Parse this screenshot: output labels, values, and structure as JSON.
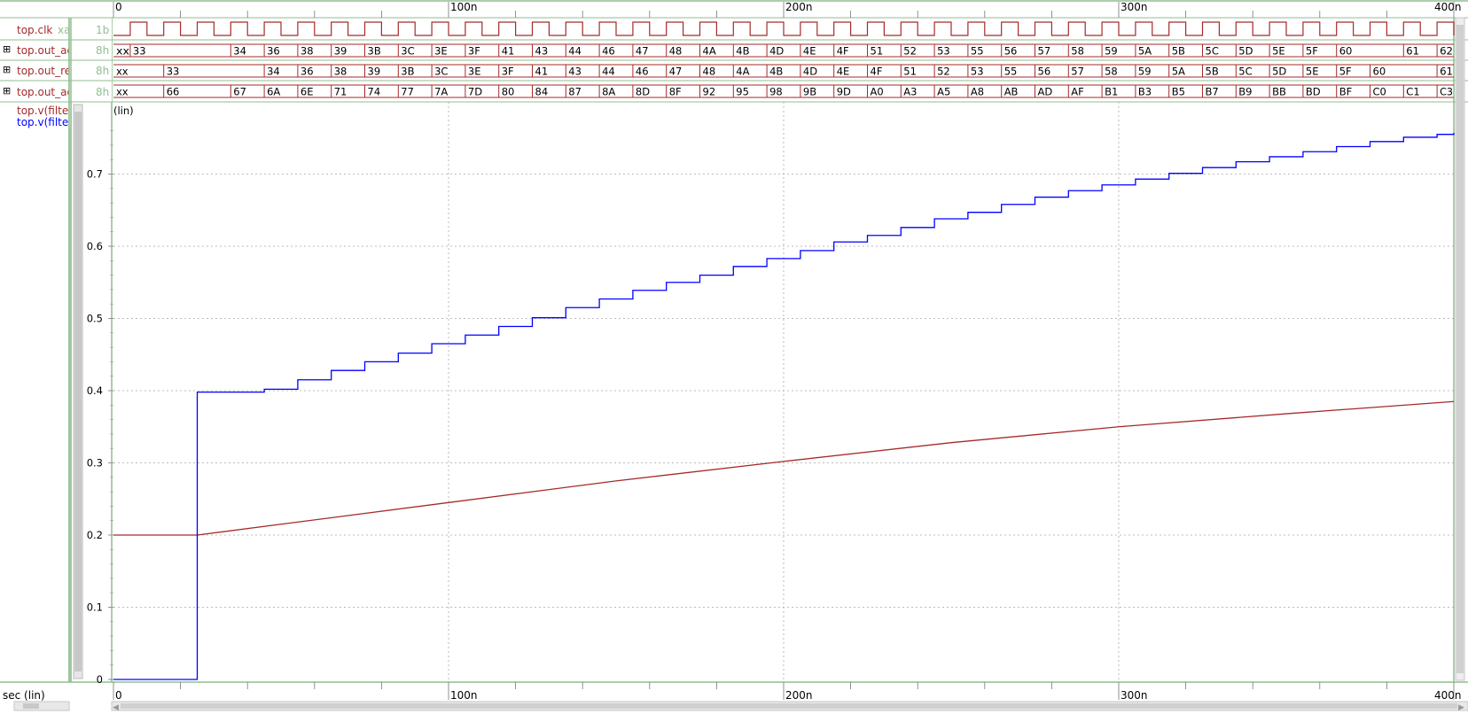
{
  "colors": {
    "signal_name": "#a52a2a",
    "trace_red": "#a52a2a",
    "trace_blue": "#0000ff",
    "size_label": "#8fbf8f",
    "frame_green": "#8fbf8f",
    "grid": "#a8a8a8"
  },
  "signals": [
    {
      "name": "top.clk",
      "suffix": "xa",
      "size": "1b",
      "expandable": false,
      "kind": "clock",
      "period_ns": 10,
      "first_rise_ns": 5
    },
    {
      "name": "top.out_ad",
      "size": "8h",
      "expandable": true,
      "kind": "bus",
      "segments": [
        {
          "t": 0,
          "v": "xx"
        },
        {
          "t": 5,
          "v": "33"
        },
        {
          "t": 35,
          "v": "34"
        },
        {
          "t": 45,
          "v": "36"
        },
        {
          "t": 55,
          "v": "38"
        },
        {
          "t": 65,
          "v": "39"
        },
        {
          "t": 75,
          "v": "3B"
        },
        {
          "t": 85,
          "v": "3C"
        },
        {
          "t": 95,
          "v": "3E"
        },
        {
          "t": 105,
          "v": "3F"
        },
        {
          "t": 115,
          "v": "41"
        },
        {
          "t": 125,
          "v": "43"
        },
        {
          "t": 135,
          "v": "44"
        },
        {
          "t": 145,
          "v": "46"
        },
        {
          "t": 155,
          "v": "47"
        },
        {
          "t": 165,
          "v": "48"
        },
        {
          "t": 175,
          "v": "4A"
        },
        {
          "t": 185,
          "v": "4B"
        },
        {
          "t": 195,
          "v": "4D"
        },
        {
          "t": 205,
          "v": "4E"
        },
        {
          "t": 215,
          "v": "4F"
        },
        {
          "t": 225,
          "v": "51"
        },
        {
          "t": 235,
          "v": "52"
        },
        {
          "t": 245,
          "v": "53"
        },
        {
          "t": 255,
          "v": "55"
        },
        {
          "t": 265,
          "v": "56"
        },
        {
          "t": 275,
          "v": "57"
        },
        {
          "t": 285,
          "v": "58"
        },
        {
          "t": 295,
          "v": "59"
        },
        {
          "t": 305,
          "v": "5A"
        },
        {
          "t": 315,
          "v": "5B"
        },
        {
          "t": 325,
          "v": "5C"
        },
        {
          "t": 335,
          "v": "5D"
        },
        {
          "t": 345,
          "v": "5E"
        },
        {
          "t": 355,
          "v": "5F"
        },
        {
          "t": 365,
          "v": "60"
        },
        {
          "t": 385,
          "v": "61"
        },
        {
          "t": 395,
          "v": "62"
        }
      ]
    },
    {
      "name": "top.out_re",
      "size": "8h",
      "expandable": true,
      "kind": "bus",
      "segments": [
        {
          "t": 0,
          "v": "xx"
        },
        {
          "t": 15,
          "v": "33"
        },
        {
          "t": 45,
          "v": "34"
        },
        {
          "t": 55,
          "v": "36"
        },
        {
          "t": 65,
          "v": "38"
        },
        {
          "t": 75,
          "v": "39"
        },
        {
          "t": 85,
          "v": "3B"
        },
        {
          "t": 95,
          "v": "3C"
        },
        {
          "t": 105,
          "v": "3E"
        },
        {
          "t": 115,
          "v": "3F"
        },
        {
          "t": 125,
          "v": "41"
        },
        {
          "t": 135,
          "v": "43"
        },
        {
          "t": 145,
          "v": "44"
        },
        {
          "t": 155,
          "v": "46"
        },
        {
          "t": 165,
          "v": "47"
        },
        {
          "t": 175,
          "v": "48"
        },
        {
          "t": 185,
          "v": "4A"
        },
        {
          "t": 195,
          "v": "4B"
        },
        {
          "t": 205,
          "v": "4D"
        },
        {
          "t": 215,
          "v": "4E"
        },
        {
          "t": 225,
          "v": "4F"
        },
        {
          "t": 235,
          "v": "51"
        },
        {
          "t": 245,
          "v": "52"
        },
        {
          "t": 255,
          "v": "53"
        },
        {
          "t": 265,
          "v": "55"
        },
        {
          "t": 275,
          "v": "56"
        },
        {
          "t": 285,
          "v": "57"
        },
        {
          "t": 295,
          "v": "58"
        },
        {
          "t": 305,
          "v": "59"
        },
        {
          "t": 315,
          "v": "5A"
        },
        {
          "t": 325,
          "v": "5B"
        },
        {
          "t": 335,
          "v": "5C"
        },
        {
          "t": 345,
          "v": "5D"
        },
        {
          "t": 355,
          "v": "5E"
        },
        {
          "t": 365,
          "v": "5F"
        },
        {
          "t": 375,
          "v": "60"
        },
        {
          "t": 395,
          "v": "61"
        }
      ]
    },
    {
      "name": "top.out_ad",
      "size": "8h",
      "expandable": true,
      "kind": "bus",
      "segments": [
        {
          "t": 0,
          "v": "xx"
        },
        {
          "t": 15,
          "v": "66"
        },
        {
          "t": 35,
          "v": "67"
        },
        {
          "t": 45,
          "v": "6A"
        },
        {
          "t": 55,
          "v": "6E"
        },
        {
          "t": 65,
          "v": "71"
        },
        {
          "t": 75,
          "v": "74"
        },
        {
          "t": 85,
          "v": "77"
        },
        {
          "t": 95,
          "v": "7A"
        },
        {
          "t": 105,
          "v": "7D"
        },
        {
          "t": 115,
          "v": "80"
        },
        {
          "t": 125,
          "v": "84"
        },
        {
          "t": 135,
          "v": "87"
        },
        {
          "t": 145,
          "v": "8A"
        },
        {
          "t": 155,
          "v": "8D"
        },
        {
          "t": 165,
          "v": "8F"
        },
        {
          "t": 175,
          "v": "92"
        },
        {
          "t": 185,
          "v": "95"
        },
        {
          "t": 195,
          "v": "98"
        },
        {
          "t": 205,
          "v": "9B"
        },
        {
          "t": 215,
          "v": "9D"
        },
        {
          "t": 225,
          "v": "A0"
        },
        {
          "t": 235,
          "v": "A3"
        },
        {
          "t": 245,
          "v": "A5"
        },
        {
          "t": 255,
          "v": "A8"
        },
        {
          "t": 265,
          "v": "AB"
        },
        {
          "t": 275,
          "v": "AD"
        },
        {
          "t": 285,
          "v": "AF"
        },
        {
          "t": 295,
          "v": "B1"
        },
        {
          "t": 305,
          "v": "B3"
        },
        {
          "t": 315,
          "v": "B5"
        },
        {
          "t": 325,
          "v": "B7"
        },
        {
          "t": 335,
          "v": "B9"
        },
        {
          "t": 345,
          "v": "BB"
        },
        {
          "t": 355,
          "v": "BD"
        },
        {
          "t": 365,
          "v": "BF"
        },
        {
          "t": 375,
          "v": "C0"
        },
        {
          "t": 385,
          "v": "C1"
        },
        {
          "t": 395,
          "v": "C3"
        }
      ]
    }
  ],
  "analog": {
    "scale_label": "(lin)",
    "traces": [
      {
        "name": "top.v(filte",
        "color": "#a52a2a"
      },
      {
        "name": "top.v(filte",
        "color": "#0000ff"
      }
    ],
    "yticks": [
      "0",
      "0.1",
      "0.2",
      "0.3",
      "0.4",
      "0.5",
      "0.6",
      "0.7"
    ]
  },
  "time_axis": {
    "labels": [
      "0",
      "100n",
      "200n",
      "300n",
      "400n"
    ],
    "bottom_label": "sec (lin)"
  },
  "chart_data": {
    "type": "line",
    "xlabel": "sec (lin)",
    "xlim": [
      0,
      400
    ],
    "x_unit": "n",
    "ylim": [
      0,
      0.76
    ],
    "grid": true,
    "series": [
      {
        "name": "top.v(filte",
        "color": "#a52a2a",
        "x": [
          0,
          25,
          50,
          100,
          150,
          200,
          250,
          300,
          350,
          400
        ],
        "y": [
          0.2,
          0.2,
          0.215,
          0.245,
          0.275,
          0.302,
          0.328,
          0.35,
          0.368,
          0.385
        ]
      },
      {
        "name": "top.v(filte",
        "color": "#0000ff",
        "step": true,
        "x": [
          0,
          25,
          45,
          55,
          65,
          75,
          85,
          95,
          105,
          115,
          125,
          135,
          145,
          155,
          165,
          175,
          185,
          195,
          205,
          215,
          225,
          235,
          245,
          255,
          265,
          275,
          285,
          295,
          305,
          315,
          325,
          335,
          345,
          355,
          365,
          375,
          385,
          395,
          400
        ],
        "y": [
          0,
          0.398,
          0.402,
          0.415,
          0.428,
          0.44,
          0.452,
          0.465,
          0.477,
          0.489,
          0.501,
          0.515,
          0.527,
          0.539,
          0.55,
          0.56,
          0.572,
          0.583,
          0.594,
          0.606,
          0.615,
          0.626,
          0.638,
          0.647,
          0.658,
          0.668,
          0.677,
          0.685,
          0.693,
          0.701,
          0.709,
          0.717,
          0.724,
          0.731,
          0.738,
          0.745,
          0.751,
          0.755,
          0.757
        ]
      }
    ]
  }
}
